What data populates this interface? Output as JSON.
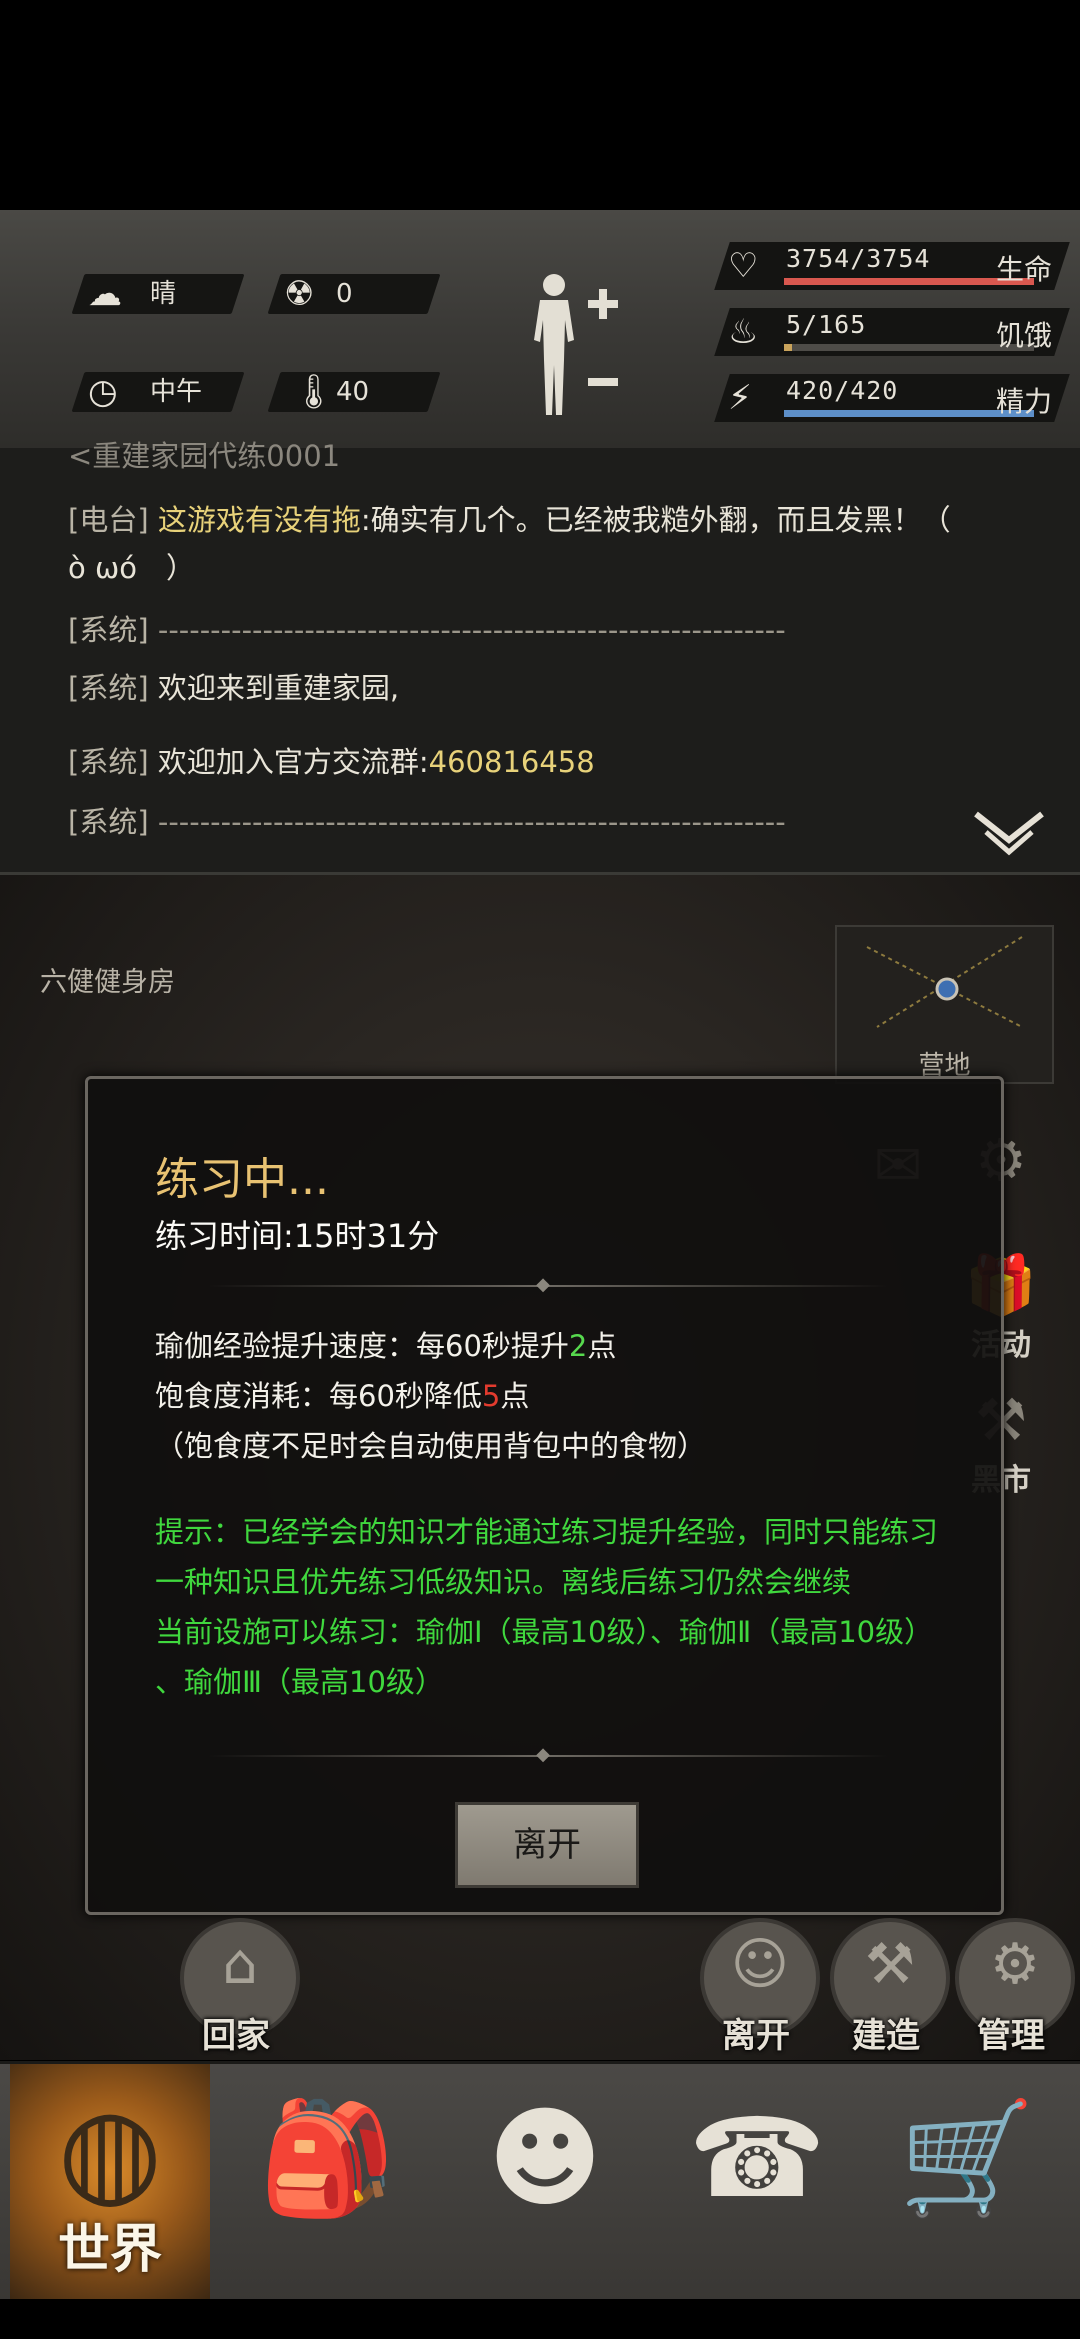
{
  "status": {
    "weather": "晴",
    "radiation": "0",
    "time_of_day": "中午",
    "temperature": "40"
  },
  "vitals": {
    "health": {
      "text": "3754/3754",
      "label": "生命",
      "fraction": 1.0,
      "color": "#d9584f"
    },
    "hunger": {
      "text": "5/165",
      "label": "饥饿",
      "fraction": 0.03,
      "color": "#c9a35b"
    },
    "energy": {
      "text": "420/420",
      "label": "精力",
      "fraction": 1.0,
      "color": "#5d8fc8"
    }
  },
  "chat": {
    "cutoff_line": "<重建家园代练0001",
    "line1_tag": "[电台]",
    "line1_yellow": "这游戏有没有拖",
    "line1_rest": ":确实有几个。已经被我糙外翻，而且发黑！（",
    "line1_cont": "ò ωó　）",
    "line2_tag": "[系统]",
    "line2_text": "------------------------------------------------------------",
    "line3_tag": "[系统]",
    "line3_text": "欢迎来到重建家园,",
    "line4_tag": "[系统]",
    "line4_text": " 欢迎加入官方交流群:",
    "line4_group": "460816458",
    "line5_tag": "[系统]",
    "line5_text": "------------------------------------------------------------"
  },
  "scene": {
    "room_name": "六健健身房",
    "map_label": "营地",
    "side": {
      "activity_label": "活动",
      "market_label": "黑市"
    }
  },
  "dialog": {
    "title": "练习中...",
    "time": "练习时间:15时31分",
    "exp_prefix": "瑜伽经验提升速度：每60秒提升",
    "exp_value": "2",
    "exp_suffix": "点",
    "food_prefix": "饱食度消耗：每60秒降低",
    "food_value": "5",
    "food_suffix": "点",
    "food_note": "（饱食度不足时会自动使用背包中的食物）",
    "hint1": "提示：已经学会的知识才能通过练习提升经验，同时只能练习",
    "hint2": "一种知识且优先练习低级知识。离线后练习仍然会继续",
    "hint3": "当前设施可以练习：瑜伽Ⅰ（最高10级）、瑜伽Ⅱ（最高10级）",
    "hint4": "、瑜伽Ⅲ（最高10级）",
    "leave_button": "离开"
  },
  "actions": {
    "home": "回家",
    "leave": "离开",
    "build": "建造",
    "manage": "管理"
  },
  "nav": {
    "world": "世界"
  }
}
